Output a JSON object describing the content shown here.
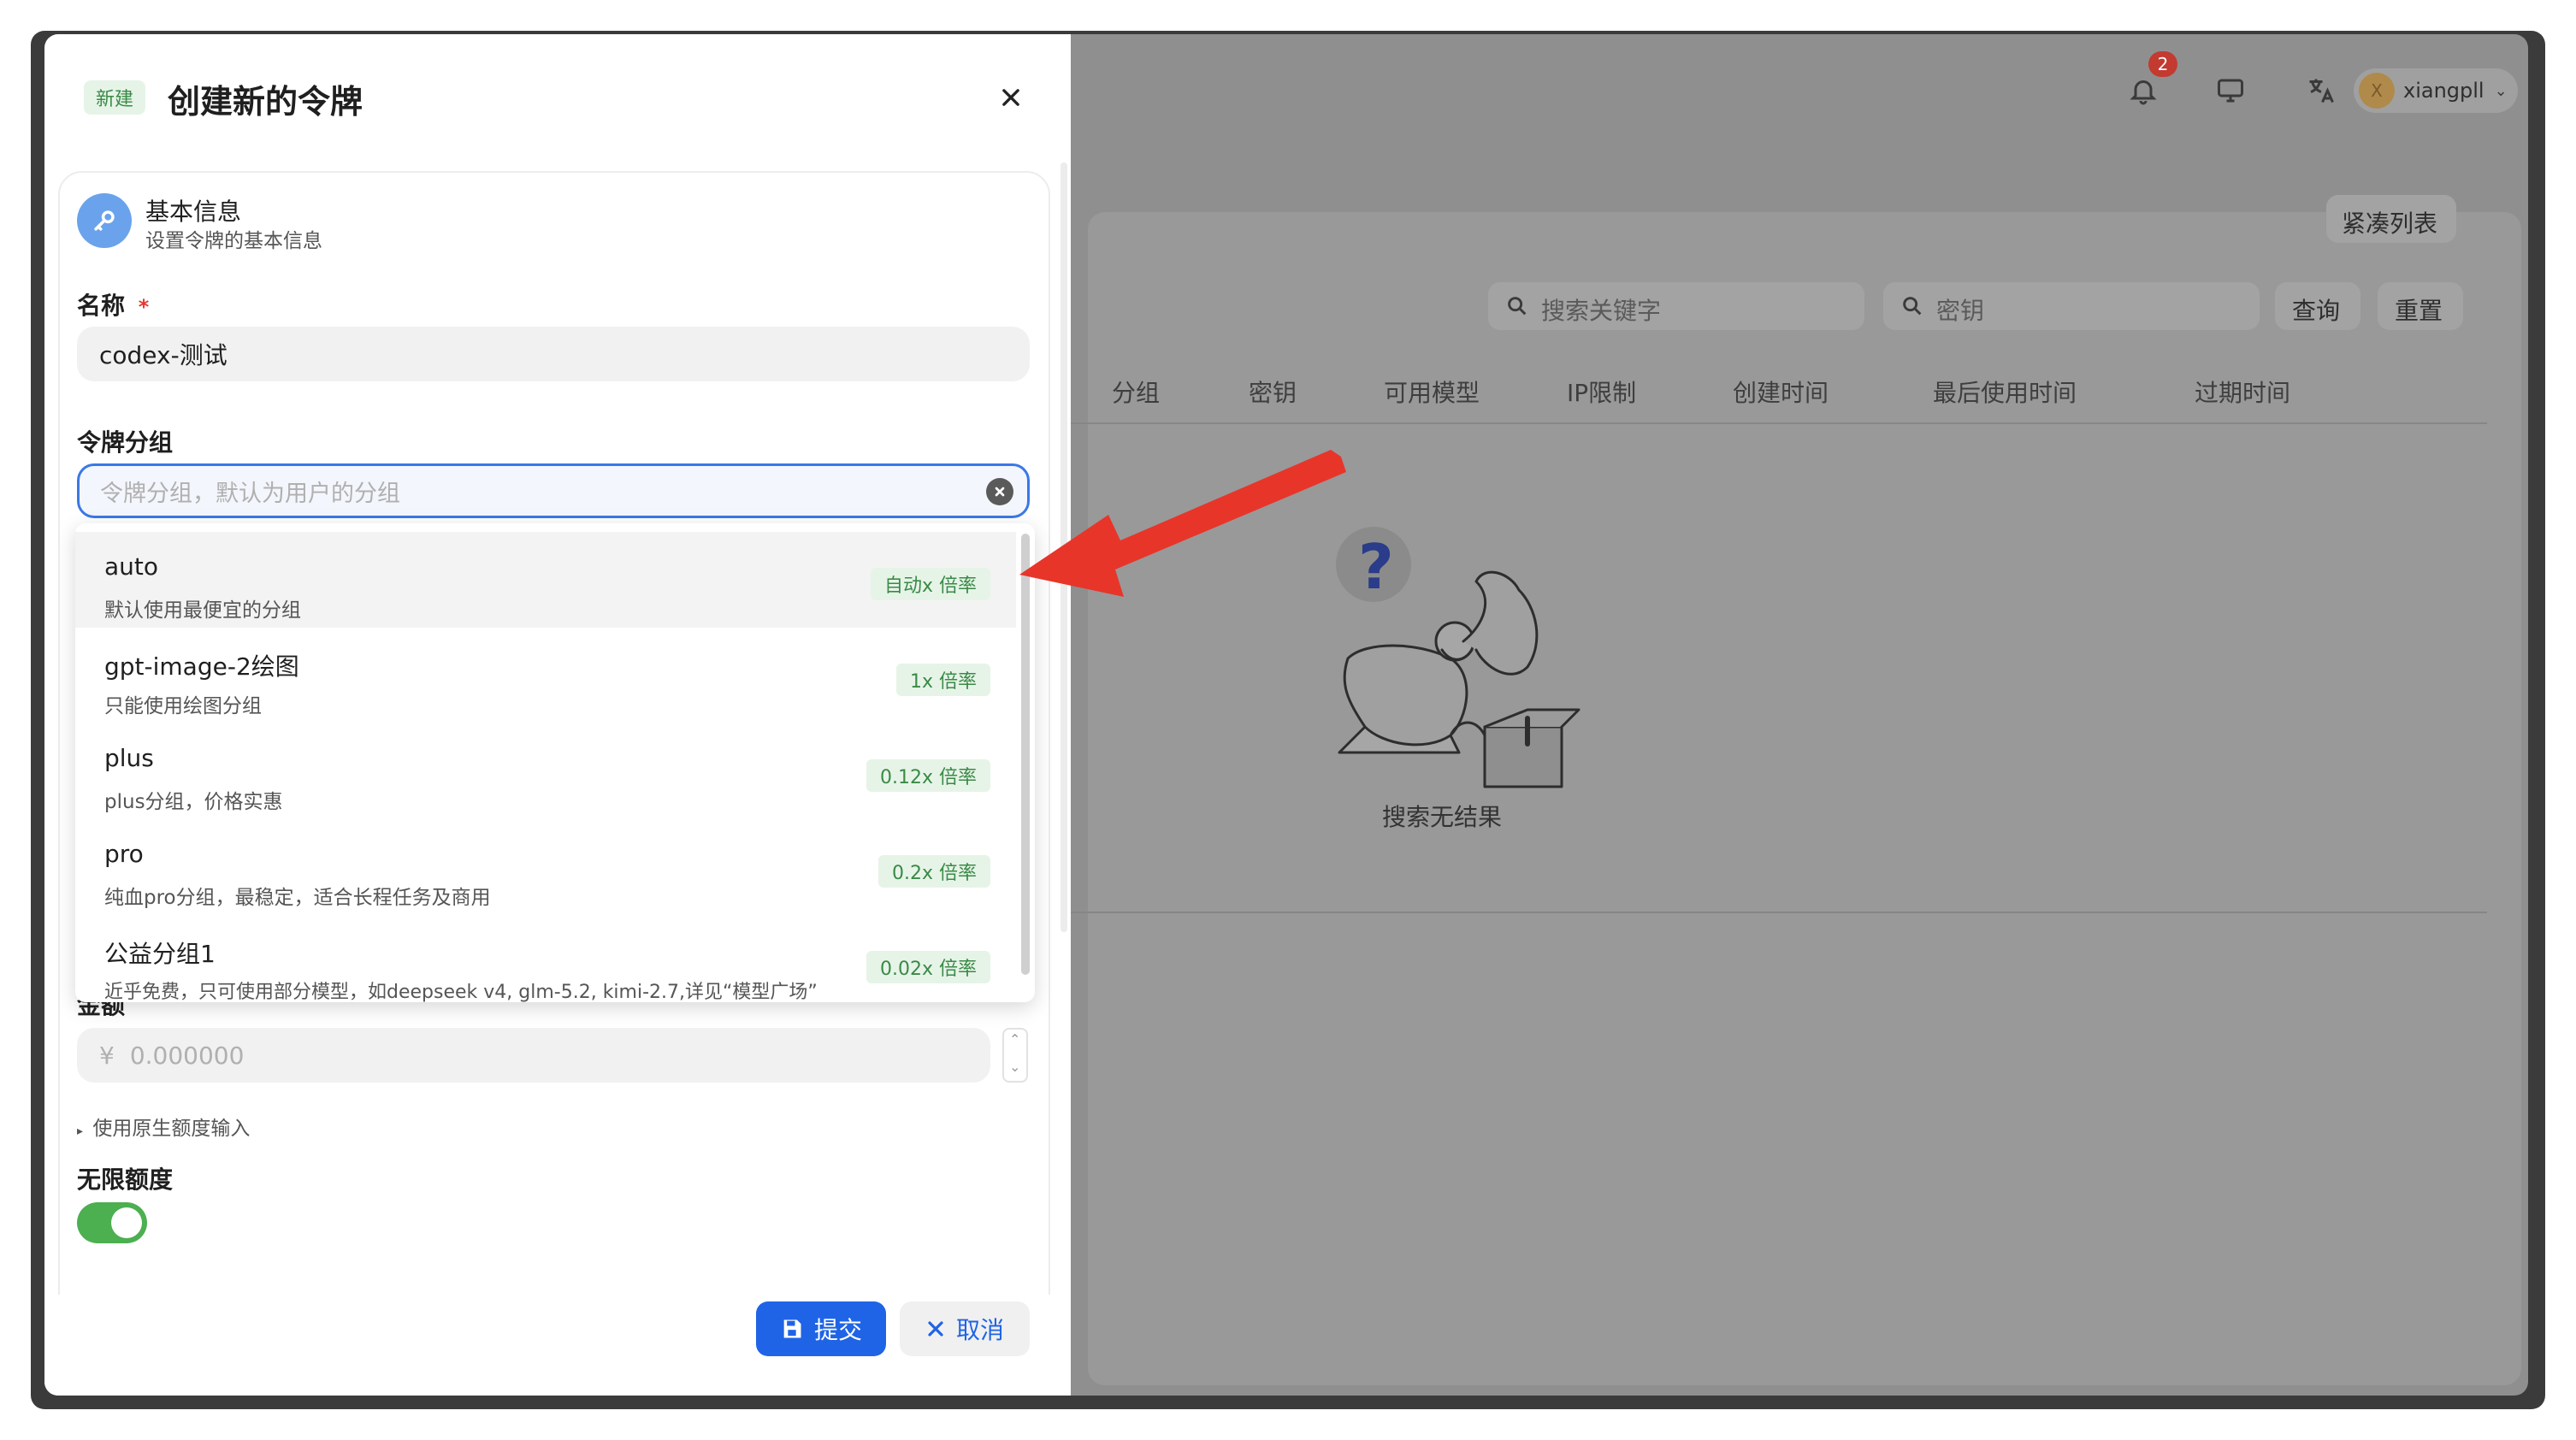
{
  "background": {
    "notification_count": "2",
    "username": "xiangpll",
    "compact_list_label": "紧凑列表",
    "search_keyword_placeholder": "搜索关键字",
    "search_key_placeholder": "密钥",
    "query_label": "查询",
    "reset_label": "重置",
    "columns": [
      "分组",
      "密钥",
      "可用模型",
      "IP限制",
      "创建时间",
      "最后使用时间",
      "过期时间"
    ],
    "empty_text": "搜索无结果"
  },
  "drawer": {
    "tag": "新建",
    "title": "创建新的令牌",
    "section": {
      "title": "基本信息",
      "subtitle": "设置令牌的基本信息"
    },
    "name_label": "名称",
    "required_mark": "*",
    "name_value": "codex-测试",
    "group_label": "令牌分组",
    "group_placeholder": "令牌分组，默认为用户的分组",
    "amount_label": "金额",
    "currency_symbol": "¥",
    "amount_placeholder": "0.000000",
    "raw_quota_toggle": "使用原生额度输入",
    "unlimited_label": "无限额度",
    "unlimited_enabled": true,
    "submit_label": "提交",
    "cancel_label": "取消"
  },
  "group_options": [
    {
      "name": "auto",
      "desc": "默认使用最便宜的分组",
      "badge": "自动x 倍率"
    },
    {
      "name": "gpt-image-2绘图",
      "desc": "只能使用绘图分组",
      "badge": "1x 倍率"
    },
    {
      "name": "plus",
      "desc": "plus分组，价格实惠",
      "badge": "0.12x 倍率"
    },
    {
      "name": "pro",
      "desc": "纯血pro分组，最稳定，适合长程任务及商用",
      "badge": "0.2x 倍率"
    },
    {
      "name": "公益分组1",
      "desc": "近乎免费，只可使用部分模型，如deepseek v4, glm-5.2, kimi-2.7,详见“模型广场”",
      "badge": "0.02x 倍率"
    }
  ],
  "colors": {
    "primary": "#1f64e6",
    "badge_bg": "#e6f4e8",
    "badge_text": "#3a8a46",
    "toggle_on": "#4caf50",
    "arrow": "#e8352a",
    "required": "#e53935",
    "notification": "#e53935"
  },
  "icons": {
    "close": "close-icon",
    "key": "key-icon",
    "clear": "clear-icon",
    "save": "save-icon",
    "cancel": "x-icon",
    "bell": "bell-icon",
    "monitor": "monitor-icon",
    "translate": "translate-icon",
    "search": "search-icon"
  }
}
